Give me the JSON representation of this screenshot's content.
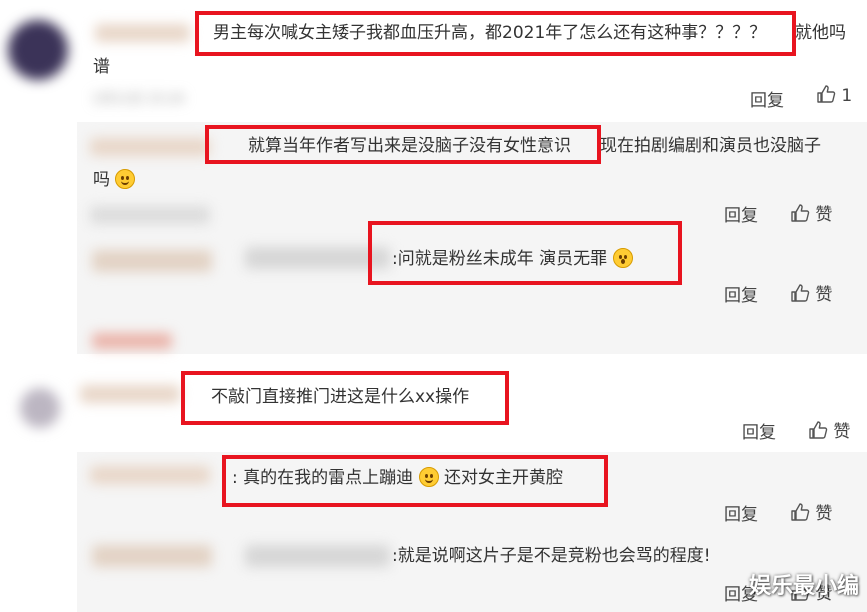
{
  "comments": [
    {
      "text_a": "男主每次喊女主矮子我都血压升高，都2021年了怎么还有这种事？？？？",
      "text_b": "就他吗",
      "text_c": "谱",
      "timestamp": "1月11日 15:24",
      "reply": "回复",
      "likes": "1"
    },
    {
      "text_a": "就算当年作者写出来是没脑子没有女性意识",
      "text_b": "现在拍剧编剧和演员也没脑子",
      "text_c": "吗",
      "reply": "回复",
      "like": "赞"
    },
    {
      "text": ":问就是粉丝未成年 演员无罪",
      "reply": "回复",
      "like": "赞"
    },
    {
      "text": "不敲门直接推门进这是什么xx操作",
      "reply": "回复",
      "like": "赞"
    },
    {
      "text_a": ":  真的在我的雷点上蹦迪",
      "text_b": "还对女主开黄腔",
      "reply": "回复",
      "like": "赞"
    },
    {
      "text": ":就是说啊这片子是不是竞粉也会骂的程度!",
      "reply": "回复",
      "like": "赞"
    }
  ],
  "watermark": "娱乐最小编",
  "colors": {
    "highlight": "#e8141f",
    "reply_panel": "#f5f5f5"
  },
  "icons": [
    "thumbs-up-icon",
    "grin-emoji-icon",
    "shocked-emoji-icon"
  ]
}
